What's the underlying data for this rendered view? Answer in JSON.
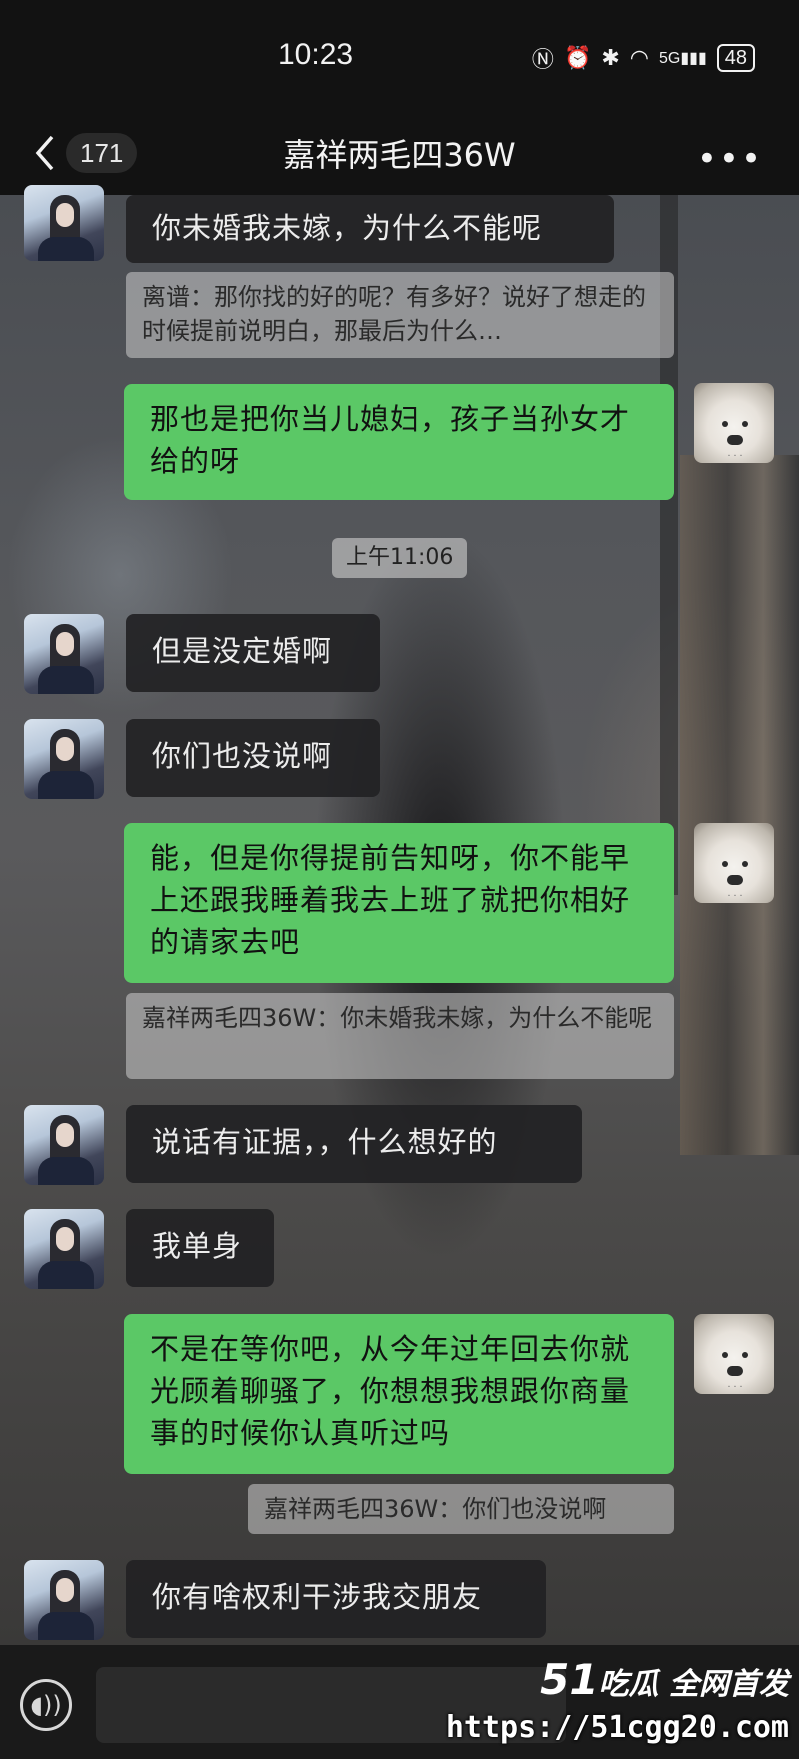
{
  "status_bar": {
    "time": "10:23",
    "icons": [
      "nfc-icon",
      "alarm-icon",
      "bluetooth-icon",
      "wifi-icon",
      "signal-5g-icon"
    ],
    "signal_label": "5G",
    "battery": "48"
  },
  "nav": {
    "unread_count": "171",
    "title": "嘉祥两毛四36W"
  },
  "messages": {
    "m1": "你未婚我未嫁，为什么不能呢",
    "q1": "离谱：那你找的好的呢？有多好？说好了想走的时候提前说明白，那最后为什么…",
    "m2": "那也是把你当儿媳妇，孩子当孙女才给的呀",
    "timestamp": "上午11:06",
    "m3": "但是没定婚啊",
    "m4": "你们也没说啊",
    "m5": "能，但是你得提前告知呀，你不能早上还跟我睡着我去上班了就把你相好的请家去吧",
    "q2": "嘉祥两毛四36W：你未婚我未嫁，为什么不能呢",
    "m6": "说话有证据，，什么想好的",
    "m7": "我单身",
    "m8": "不是在等你吧，从今年过年回去你就光顾着聊骚了，你想想我想跟你商量事的时候你认真听过吗",
    "q3": "嘉祥两毛四36W：你们也没说啊",
    "m9": "你有啥权利干涉我交朋友"
  },
  "watermark": {
    "brand_num": "51",
    "brand_text": "吃瓜 全网首发",
    "url": "https://51cgg20.com"
  },
  "colors": {
    "bubble_right": "#5bc866",
    "bubble_left": "#222224",
    "bar_bg": "#121212"
  }
}
